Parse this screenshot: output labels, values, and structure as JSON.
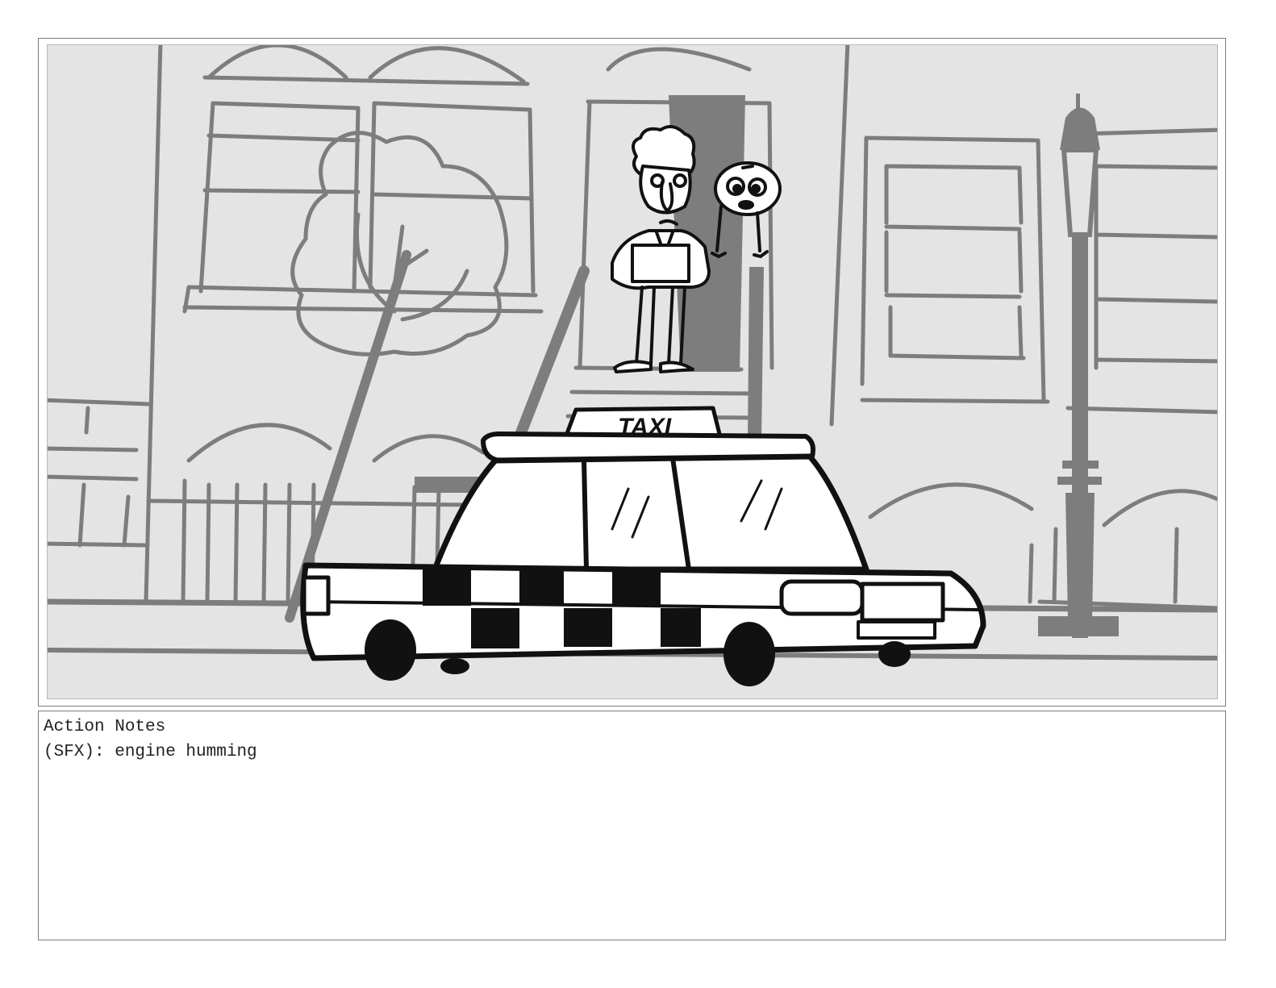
{
  "panel": {
    "sign_text": "TAXI"
  },
  "notes": {
    "heading": "Action Notes",
    "lines": [
      "(SFX): engine humming"
    ]
  }
}
